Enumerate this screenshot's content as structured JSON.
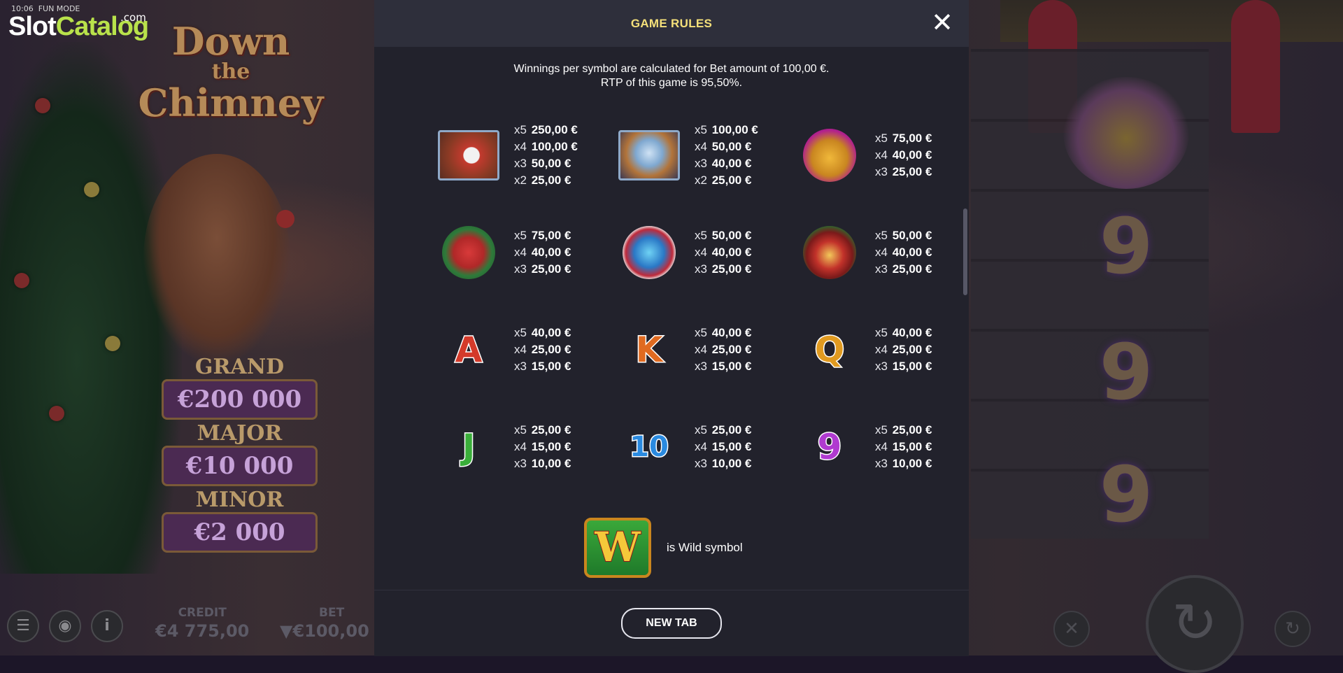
{
  "logo": {
    "time": "10:06",
    "mode": "FUN MODE",
    "word1": "Slot",
    "word2": "Catalog",
    "suffix": ".com"
  },
  "game": {
    "title_line1": "Down",
    "title_line2": "the",
    "title_line3": "Chimney"
  },
  "jackpots": [
    {
      "label": "GRAND",
      "value": "€200 000"
    },
    {
      "label": "MAJOR",
      "value": "€10 000"
    },
    {
      "label": "MINOR",
      "value": "€2 000"
    }
  ],
  "hud": {
    "credit_label": "CREDIT",
    "credit_value": "€4 775,00",
    "bet_label": "BET",
    "bet_value": "▼€100,00"
  },
  "reels": {
    "nine": "9"
  },
  "icons": {
    "menu": "menu-icon",
    "sound": "sound-icon",
    "info": "info-icon",
    "close": "close-icon",
    "autoplay": "autoplay-icon",
    "spin": "spin-icon",
    "turbo": "turbo-icon"
  },
  "modal": {
    "title": "GAME RULES",
    "intro_line1": "Winnings per symbol are calculated for Bet amount of 100,00 €.",
    "intro_line2": "RTP of this game is 95,50%.",
    "wild_text": "is Wild symbol",
    "wild_letter": "W",
    "footer_button": "NEW TAB",
    "symbols": [
      [
        {
          "name": "santa",
          "pays": [
            [
              "x5",
              "250,00 €"
            ],
            [
              "x4",
              "100,00 €"
            ],
            [
              "x3",
              "50,00 €"
            ],
            [
              "x2",
              "25,00 €"
            ]
          ]
        },
        {
          "name": "snow-globe",
          "pays": [
            [
              "x5",
              "100,00 €"
            ],
            [
              "x4",
              "50,00 €"
            ],
            [
              "x3",
              "40,00 €"
            ],
            [
              "x2",
              "25,00 €"
            ]
          ]
        },
        {
          "name": "bell",
          "pays": [
            [
              "x5",
              "75,00 €"
            ],
            [
              "x4",
              "40,00 €"
            ],
            [
              "x3",
              "25,00 €"
            ]
          ]
        }
      ],
      [
        {
          "name": "stocking",
          "pays": [
            [
              "x5",
              "75,00 €"
            ],
            [
              "x4",
              "40,00 €"
            ],
            [
              "x3",
              "25,00 €"
            ]
          ]
        },
        {
          "name": "ornament",
          "pays": [
            [
              "x5",
              "50,00 €"
            ],
            [
              "x4",
              "40,00 €"
            ],
            [
              "x3",
              "25,00 €"
            ]
          ]
        },
        {
          "name": "candle",
          "pays": [
            [
              "x5",
              "50,00 €"
            ],
            [
              "x4",
              "40,00 €"
            ],
            [
              "x3",
              "25,00 €"
            ]
          ]
        }
      ],
      [
        {
          "name": "A",
          "pays": [
            [
              "x5",
              "40,00 €"
            ],
            [
              "x4",
              "25,00 €"
            ],
            [
              "x3",
              "15,00 €"
            ]
          ]
        },
        {
          "name": "K",
          "pays": [
            [
              "x5",
              "40,00 €"
            ],
            [
              "x4",
              "25,00 €"
            ],
            [
              "x3",
              "15,00 €"
            ]
          ]
        },
        {
          "name": "Q",
          "pays": [
            [
              "x5",
              "40,00 €"
            ],
            [
              "x4",
              "25,00 €"
            ],
            [
              "x3",
              "15,00 €"
            ]
          ]
        }
      ],
      [
        {
          "name": "J",
          "pays": [
            [
              "x5",
              "25,00 €"
            ],
            [
              "x4",
              "15,00 €"
            ],
            [
              "x3",
              "10,00 €"
            ]
          ]
        },
        {
          "name": "10",
          "pays": [
            [
              "x5",
              "25,00 €"
            ],
            [
              "x4",
              "15,00 €"
            ],
            [
              "x3",
              "10,00 €"
            ]
          ]
        },
        {
          "name": "9",
          "pays": [
            [
              "x5",
              "25,00 €"
            ],
            [
              "x4",
              "15,00 €"
            ],
            [
              "x3",
              "10,00 €"
            ]
          ]
        }
      ]
    ]
  }
}
